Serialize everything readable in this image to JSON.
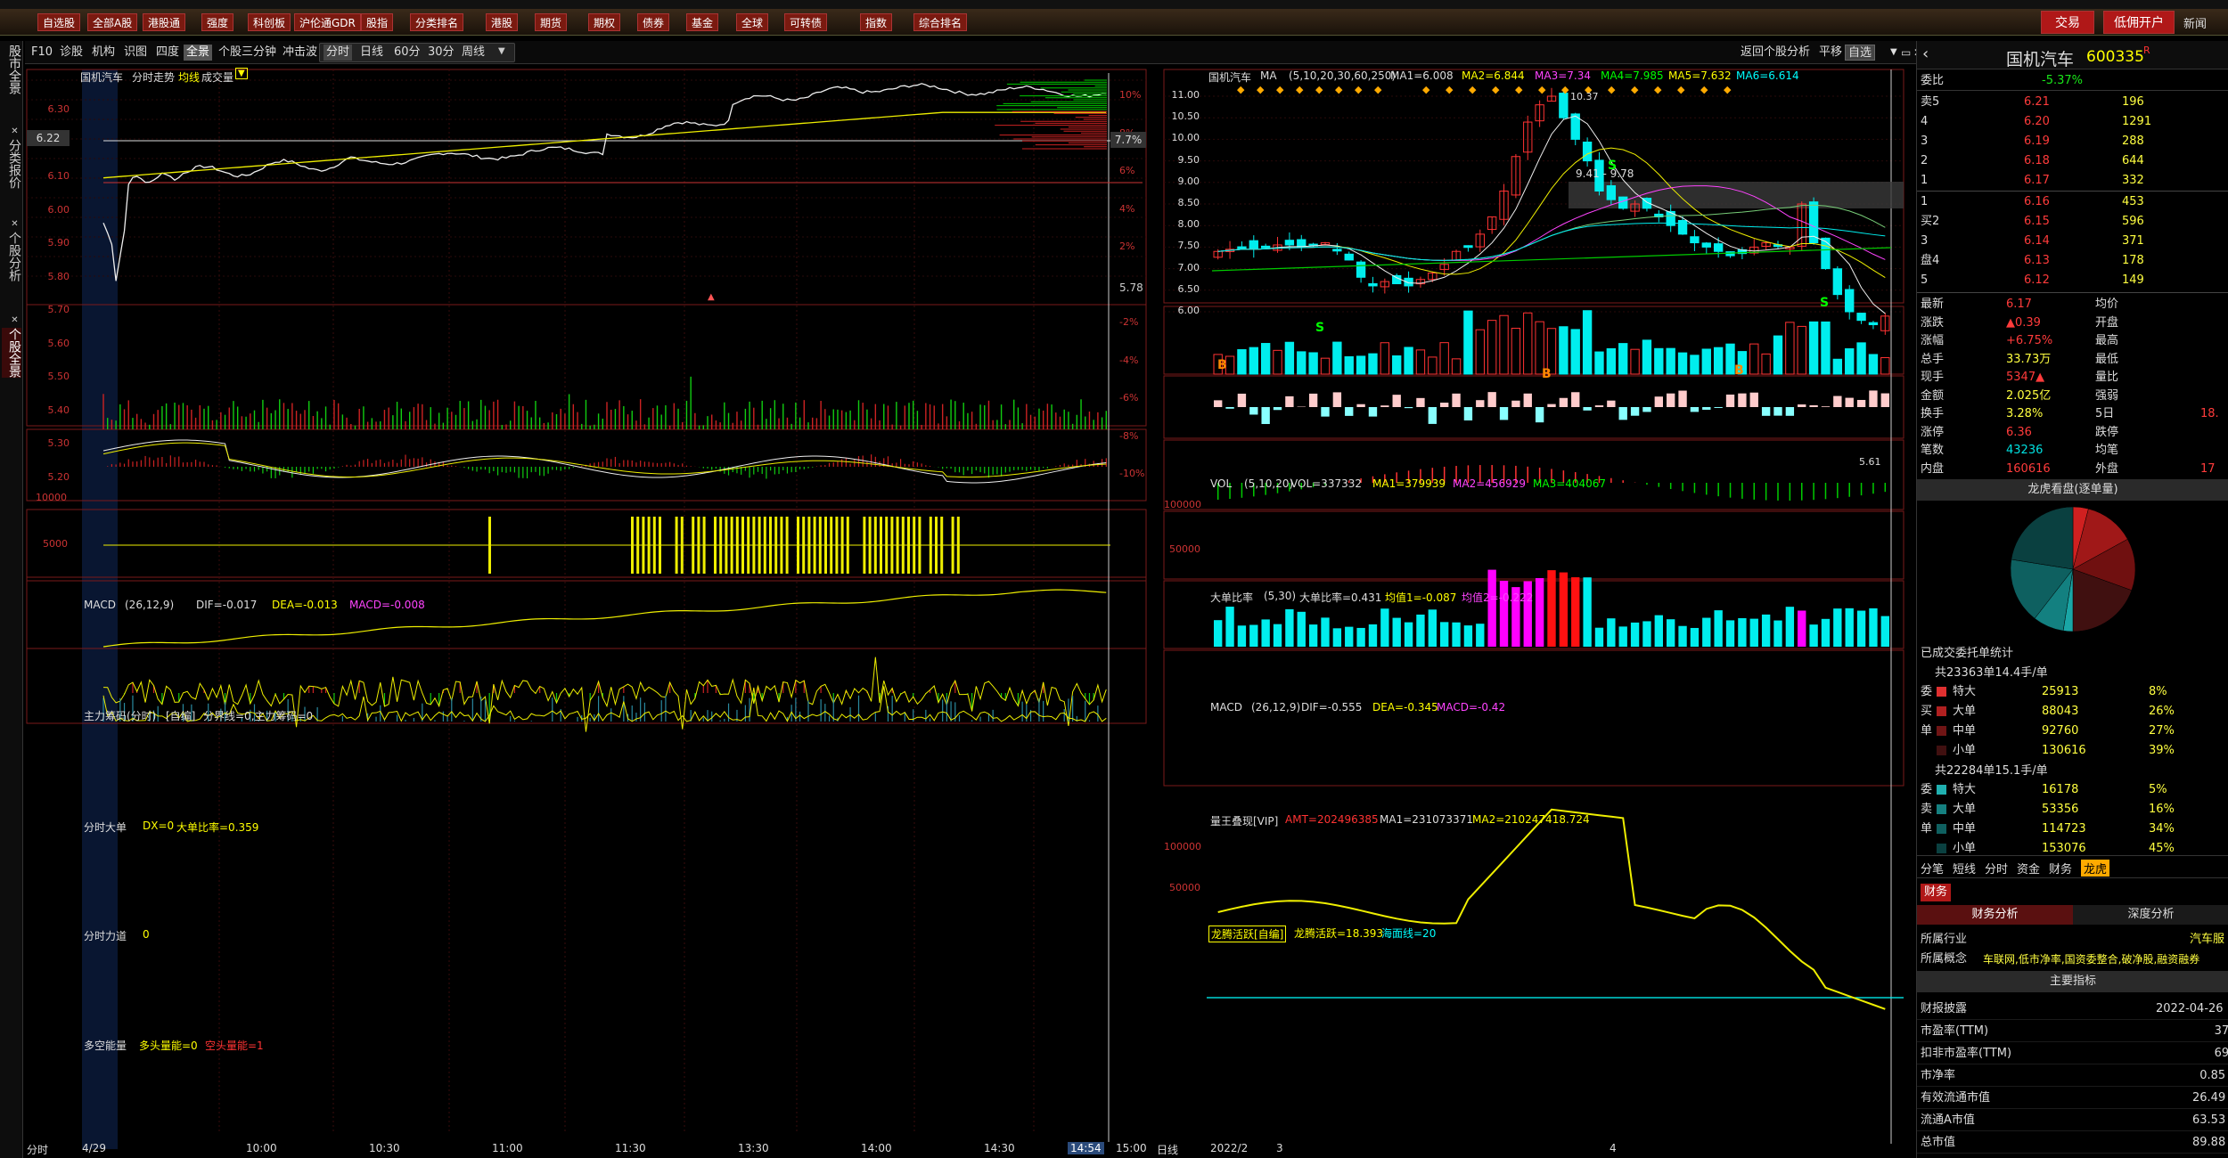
{
  "menubar": {
    "items": [
      "自选股",
      "全部A股",
      "港股通",
      "强度",
      "科创板",
      "沪伦通GDR",
      "股指",
      "分类排名",
      "港股",
      "期货",
      "期权",
      "债券",
      "基金",
      "全球",
      "可转债",
      "指数",
      "综合排名"
    ],
    "right_buttons": [
      "交易",
      "低佣开户"
    ],
    "top_right": "新闻"
  },
  "toolbar": {
    "left": [
      "F10",
      "诊股",
      "机构",
      "识图",
      "四度",
      "全景",
      "个股三分钟",
      "冲击波"
    ],
    "period": [
      "分时",
      "日线",
      "60分",
      "30分",
      "周线"
    ],
    "right": [
      "返回个股分析",
      "平移",
      "自选"
    ]
  },
  "left_tabs": [
    "股市全景",
    "分类报价",
    "个股分析",
    "个股全景"
  ],
  "intraday": {
    "header_name": "国机汽车",
    "header_items": [
      "分时走势",
      "均线",
      "成交量"
    ],
    "price_levels": [
      "6.30",
      "6.20",
      "6.10",
      "6.00",
      "5.90",
      "5.80",
      "5.70",
      "5.60",
      "5.50",
      "5.40",
      "5.30",
      "5.20"
    ],
    "pct_levels": [
      "10%",
      "8%",
      "6%",
      "4%",
      "2%",
      "",
      "-2%",
      "-4%",
      "-6%",
      "-8%",
      "-10%"
    ],
    "cur_price_tag": "6.22",
    "cur_pct_tag": "7.7%",
    "ref_price": "5.78",
    "time_labels": [
      "4/29",
      "10:00",
      "10:30",
      "11:00",
      "11:30",
      "13:30",
      "14:00",
      "14:30",
      "14:54",
      "15:00"
    ],
    "vol_label": "10000",
    "vol_label2": "5000",
    "macd_title": "MACD",
    "macd_params": "(26,12,9)",
    "macd_dif": "DIF=-0.017",
    "macd_dea": "DEA=-0.013",
    "macd_macd": "MACD=-0.008",
    "zl_title": "主力筹码(分时)",
    "zl_sub": "[自编]",
    "zl_text": "分界线=0,主力筹码=0",
    "dd_title": "分时大单",
    "dd_text": "DX=0",
    "dd_text2": "大单比率=0.359",
    "ld_title": "分时力道",
    "ld_text": "0",
    "dk_title": "多空能量",
    "dk_text": "多头量能=0",
    "dk_text2": "空头量能=1",
    "bottom_left": "分时"
  },
  "daily": {
    "name": "国机汽车",
    "ma_label": "MA",
    "ma_params": "(5,10,20,30,60,250)",
    "ma1": "MA1=6.008",
    "ma2": "MA2=6.844",
    "ma3": "MA3=7.34",
    "ma4": "MA4=7.985",
    "ma5": "MA5=7.632",
    "ma6": "MA6=6.614",
    "price_levels": [
      "11.00",
      "10.50",
      "10.00",
      "9.50",
      "9.00",
      "8.50",
      "8.00",
      "7.50",
      "7.00",
      "6.50",
      "6.00"
    ],
    "range_note": "9.41 - 9.78",
    "high_note": "10.37",
    "low_note": "5.61",
    "vol_title": "VOL",
    "vol_params": "(5,10,20)",
    "vol_text": "VOL=337332",
    "vol_ma1": "MA1=379939",
    "vol_ma2": "MA2=456929",
    "vol_ma3": "MA3=404067",
    "vol_y": [
      "100000",
      "50000"
    ],
    "ddbl_title": "大单比率",
    "ddbl_params": "(5,30)",
    "ddbl_text": "大单比率=0.431",
    "ddbl_v1": "均值1=-0.087",
    "ddbl_v2": "均值2=-0.222",
    "macd_title": "MACD",
    "macd_params": "(26,12,9)",
    "macd_dif": "DIF=-0.555",
    "macd_dea": "DEA=-0.345",
    "macd_macd": "MACD=-0.42",
    "lw_title": "量王叠现[VIP]",
    "lw_amt": "AMT=202496385",
    "lw_ma1": "MA1=231073371",
    "lw_ma2": "MA2=210247418.724",
    "lw_y": [
      "100000",
      "50000"
    ],
    "lh_title": "龙腾活跃[自编]",
    "lh_text": "龙腾活跃=18.393",
    "lh_sea": "海面线=20",
    "bottom_labels": [
      "日线",
      "2022/2",
      "3",
      "4"
    ]
  },
  "sidebar": {
    "stock_name": "国机汽车",
    "stock_code": "600335",
    "stock_suffix": "R",
    "weibi_label": "委比",
    "weibi_val": "-5.37%",
    "asks": [
      {
        "label": "卖5",
        "price": "6.21",
        "vol": "196"
      },
      {
        "label": "4",
        "price": "6.20",
        "vol": "1291"
      },
      {
        "label": "3",
        "price": "6.19",
        "vol": "288"
      },
      {
        "label": "2",
        "price": "6.18",
        "vol": "644"
      },
      {
        "label": "1",
        "price": "6.17",
        "vol": "332"
      }
    ],
    "bids": [
      {
        "label": "1",
        "price": "6.16",
        "vol": "453"
      },
      {
        "label": "买2",
        "price": "6.15",
        "vol": "596"
      },
      {
        "label": "3",
        "price": "6.14",
        "vol": "371"
      },
      {
        "label": "盘4",
        "price": "6.13",
        "vol": "178"
      },
      {
        "label": "5",
        "price": "6.12",
        "vol": "149"
      }
    ],
    "ask_side_labels": [
      "卖",
      "盘"
    ],
    "stats": [
      {
        "k": "最新",
        "v": "6.17",
        "k2": "均价",
        "v2": ""
      },
      {
        "k": "涨跌",
        "v": "▲0.39",
        "k2": "开盘",
        "v2": ""
      },
      {
        "k": "涨幅",
        "v": "+6.75%",
        "k2": "最高",
        "v2": ""
      },
      {
        "k": "总手",
        "v": "33.73万",
        "k2": "最低",
        "v2": ""
      },
      {
        "k": "现手",
        "v": "5347▲",
        "k2": "量比",
        "v2": ""
      },
      {
        "k": "金额",
        "v": "2.025亿",
        "k2": "强弱",
        "v2": ""
      },
      {
        "k": "换手",
        "v": "3.28%",
        "k2": "5日",
        "v2": "18."
      },
      {
        "k": "涨停",
        "v": "6.36",
        "k2": "跌停",
        "v2": ""
      },
      {
        "k": "笔数",
        "v": "43236",
        "k2": "均笔",
        "v2": ""
      },
      {
        "k": "内盘",
        "v": "160616",
        "k2": "外盘",
        "v2": "17"
      }
    ],
    "pie_title": "龙虎看盘(逐单量)",
    "orders_title": "已成交委托单统计",
    "buy_group_title": "共23363单14.4手/单",
    "buy_rows": [
      {
        "side": "委",
        "type": "特大",
        "vol": "25913",
        "pct": "8%"
      },
      {
        "side": "买",
        "type": "大单",
        "vol": "88043",
        "pct": "26%"
      },
      {
        "side": "单",
        "type": "中单",
        "vol": "92760",
        "pct": "27%"
      },
      {
        "side": "",
        "type": "小单",
        "vol": "130616",
        "pct": "39%"
      }
    ],
    "sell_group_title": "共22284单15.1手/单",
    "sell_rows": [
      {
        "side": "委",
        "type": "特大",
        "vol": "16178",
        "pct": "5%"
      },
      {
        "side": "卖",
        "type": "大单",
        "vol": "53356",
        "pct": "16%"
      },
      {
        "side": "单",
        "type": "中单",
        "vol": "114723",
        "pct": "34%"
      },
      {
        "side": "",
        "type": "小单",
        "vol": "153076",
        "pct": "45%"
      }
    ],
    "bottom_tabs": [
      "分笔",
      "短线",
      "分时",
      "资金",
      "财务",
      "龙虎"
    ],
    "fin_tab": "财务",
    "fin_sub": [
      "财务分析",
      "深度分析"
    ],
    "industry_k": "所属行业",
    "industry_v": "汽车服",
    "concept_k": "所属概念",
    "concept_v": "车联网,低市净率,国资委整合,破净股,融资融券",
    "main_idx": "主要指标",
    "fin_rows": [
      {
        "k": "财报披露",
        "v": "2022-04-26"
      },
      {
        "k": "市盈率(TTM)",
        "v": "37"
      },
      {
        "k": "扣非市盈率(TTM)",
        "v": "69"
      },
      {
        "k": "市净率",
        "v": "0.85"
      },
      {
        "k": "有效流通市值",
        "v": "26.49"
      },
      {
        "k": "流通A市值",
        "v": "63.53"
      },
      {
        "k": "总市值",
        "v": "89.88"
      }
    ]
  }
}
